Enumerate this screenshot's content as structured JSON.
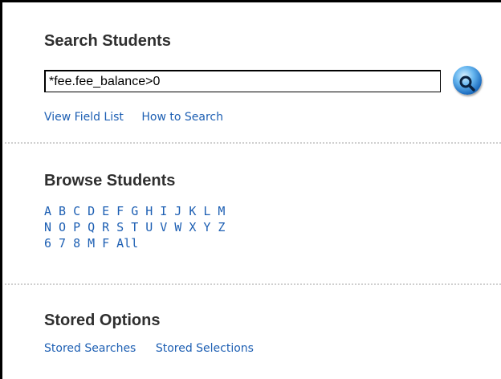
{
  "search": {
    "title": "Search Students",
    "query_value": "*fee.fee_balance>0",
    "links": {
      "view_field_list": "View Field List",
      "how_to_search": "How to Search"
    }
  },
  "browse": {
    "title": "Browse Students",
    "rows": [
      [
        "A",
        "B",
        "C",
        "D",
        "E",
        "F",
        "G",
        "H",
        "I",
        "J",
        "K",
        "L",
        "M"
      ],
      [
        "N",
        "O",
        "P",
        "Q",
        "R",
        "S",
        "T",
        "U",
        "V",
        "W",
        "X",
        "Y",
        "Z"
      ],
      [
        "6",
        "7",
        "8",
        "M",
        "F",
        "All"
      ]
    ]
  },
  "stored": {
    "title": "Stored Options",
    "links": {
      "stored_searches": "Stored Searches",
      "stored_selections": "Stored Selections"
    }
  },
  "icons": {
    "search_button": "magnifier-icon"
  }
}
